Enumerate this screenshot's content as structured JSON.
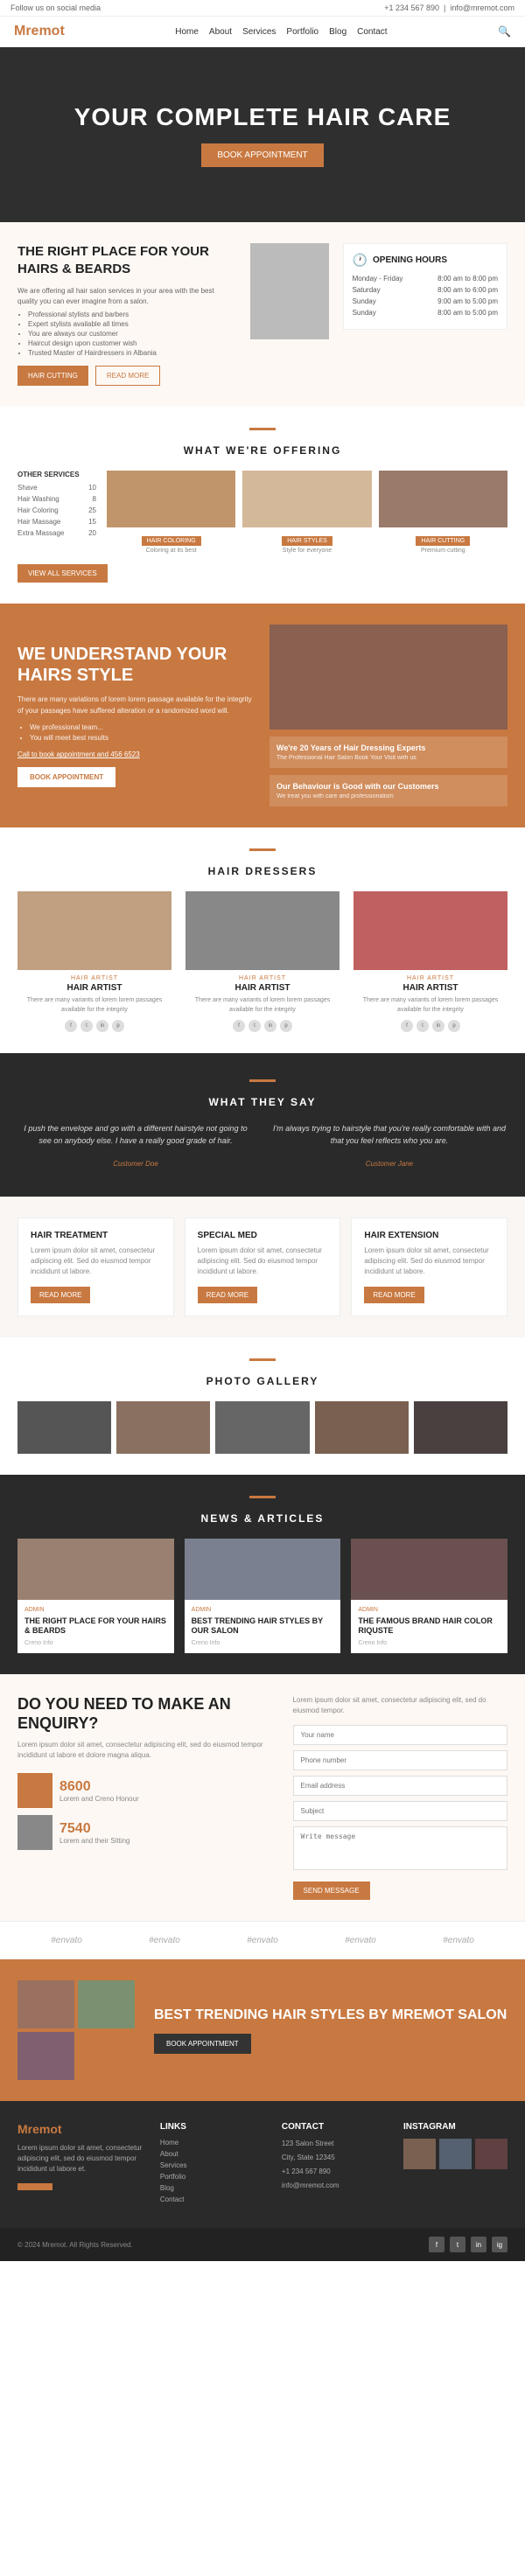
{
  "topbar": {
    "social_text": "Follow us on social media",
    "phone": "+1 234 567 890",
    "email": "info@mremot.com"
  },
  "nav": {
    "logo": "Mremot",
    "links": [
      "Home",
      "About",
      "Services",
      "Portfolio",
      "Blog",
      "Contact"
    ],
    "search_icon": "🔍"
  },
  "hero": {
    "title": "YOUR COMPLETE HAIR CARE",
    "button": "BOOK APPOINTMENT"
  },
  "intro": {
    "heading": "THE RIGHT PLACE FOR YOUR HAIRS & BEARDS",
    "description": "We are offering all hair salon services in your area with the best quality you can ever imagine from a salon.",
    "bullets": [
      "Professional stylists and barbers",
      "Expert stylists available all times",
      "You are always our customer",
      "Haircut design upon customer wish",
      "Trusted Master of Hairdressers in Albania"
    ],
    "btn_haircut": "HAIR CUTTING",
    "btn_more": "READ MORE",
    "opening_hours": {
      "title": "OPENING HOURS",
      "days": [
        {
          "day": "Monday - Friday",
          "hours": "8:00 am to 8:00 pm"
        },
        {
          "day": "Saturday",
          "hours": "8:00 am to 6:00 pm"
        },
        {
          "day": "Sunday",
          "hours": "9:00 am to 5:00 pm"
        },
        {
          "day": "Sunday",
          "hours": "8:00 am to 5:00 pm"
        }
      ]
    }
  },
  "offering": {
    "title": "WHAT WE'RE OFFERING",
    "other_services": {
      "heading": "OTHER SERVICES",
      "items": [
        {
          "name": "Shave",
          "price": "10"
        },
        {
          "name": "Hair Washing",
          "price": "8"
        },
        {
          "name": "Hair Coloring",
          "price": "25"
        },
        {
          "name": "Hair Massage",
          "price": "15"
        },
        {
          "name": "Extra Massage",
          "price": "20"
        }
      ]
    },
    "cards": [
      {
        "label": "HAIR COLORING",
        "desc": "Coloring at its best"
      },
      {
        "label": "HAIR STYLES",
        "desc": "Style for everyone"
      },
      {
        "label": "HAIR CUTTING",
        "desc": "Premium cutting"
      }
    ],
    "view_btn": "VIEW ALL SERVICES"
  },
  "understand": {
    "title": "WE UNDERSTAND YOUR HAIRS STYLE",
    "description": "There are many variations of lorem lorem passage available for the integrity of your passages have suffered alteration or a randomized word will.",
    "bullets": [
      "We professional team...",
      "You will meet best results"
    ],
    "link_text": "Call to book appointment and 456 6523",
    "btn": "BOOK APPOINTMENT",
    "badge1": {
      "heading": "We're 20 Years of Hair Dressing Experts",
      "text": "The Professional Hair Salon Book Your Visit with us"
    },
    "badge2": {
      "heading": "Our Behaviour is Good with our Customers",
      "text": "We treat you with care and professionalism"
    }
  },
  "dressers": {
    "title": "HAIR DRESSERS",
    "items": [
      {
        "role": "HAIR ARTIST",
        "name": "HAIR ARTIST",
        "desc": "There are many variants of lorem lorem passages available for the integrity"
      },
      {
        "role": "HAIR ARTIST",
        "name": "HAIR ARTIST",
        "desc": "There are many variants of lorem lorem passages available for the integrity"
      },
      {
        "role": "HAIR ARTIST",
        "name": "HAIR ARTIST",
        "desc": "There are many variants of lorem lorem passages available for the integrity"
      }
    ]
  },
  "testimonials": {
    "title": "WHAT THEY SAY",
    "items": [
      {
        "quote": "I push the envelope and go with a different hairstyle not going to see on anybody else. I have a really good grade of hair.",
        "author": "Customer Doe"
      },
      {
        "quote": "I'm always trying to hairstyle that you're really comfortable with and that you feel reflects who you are.",
        "author": "Customer Jane"
      }
    ]
  },
  "service_boxes": [
    {
      "title": "HAIR TREATMENT",
      "desc": "Lorem ipsum dolor sit amet, consectetur adipiscing elit. Sed do eiusmod tempor incididunt ut labore.",
      "btn": "READ MORE"
    },
    {
      "title": "SPECIAL MED",
      "desc": "Lorem ipsum dolor sit amet, consectetur adipiscing elit. Sed do eiusmod tempor incididunt ut labore.",
      "btn": "READ MORE"
    },
    {
      "title": "HAIR EXTENSION",
      "desc": "Lorem ipsum dolor sit amet, consectetur adipiscing elit. Sed do eiusmod tempor incididunt ut labore.",
      "btn": "READ MORE"
    }
  ],
  "gallery": {
    "title": "PHOTO GALLERY",
    "items": [
      "photo1",
      "photo2",
      "photo3",
      "photo4",
      "photo5"
    ]
  },
  "news": {
    "title": "NEWS & ARTICLES",
    "items": [
      {
        "tag": "ADMIN",
        "title": "THE RIGHT PLACE FOR YOUR HAIRS & BEARDS",
        "date": "Creno Info"
      },
      {
        "tag": "ADMIN",
        "title": "BEST TRENDING HAIR STYLES BY OUR SALON",
        "date": "Creno Info"
      },
      {
        "tag": "ADMIN",
        "title": "THE FAMOUS BRAND HAIR COLOR RIQUSTE",
        "date": "Creno Info"
      }
    ]
  },
  "enquiry": {
    "title": "DO YOU NEED TO MAKE AN ENQUIRY?",
    "desc": "Lorem ipsum dolor sit amet, consectetur adipiscing elit, sed do eiusmod tempor incididunt ut labore et dolore magna aliqua.",
    "stats": [
      {
        "number": "8600",
        "label": "Lorem and Creno Honour"
      },
      {
        "number": "7540",
        "label": "Lorem and their Sitting"
      }
    ],
    "form": {
      "intro": "Lorem ipsum dolor sit amet, consectetur adipiscing elit, sed do eiusmod tempor.",
      "your_name": "Your name",
      "phone_number": "Phone number",
      "email_address": "Email address",
      "subject": "Subject",
      "write_message": "Write message",
      "submit_btn": "SEND MESSAGE"
    }
  },
  "partners": [
    "#envato",
    "#envato",
    "#envato",
    "#envato",
    "#envato"
  ],
  "cta": {
    "title": "BEST TRENDING HAIR STYLES BY MREMOT SALON",
    "btn": "BOOK APPOINTMENT"
  },
  "footer": {
    "logo": "Mremot",
    "description": "Lorem ipsum dolor sit amet, consectetur adipiscing elit, sed do eiusmod tempor incididunt ut labore et.",
    "links_title": "LINKS",
    "links": [
      "Home",
      "About",
      "Services",
      "Portfolio",
      "Blog",
      "Contact"
    ],
    "contact_title": "CONTACT",
    "contact_info": [
      "123 Salon Street",
      "City, State 12345",
      "+1 234 567 890",
      "info@mremot.com"
    ],
    "instagram_title": "INSTAGRAM",
    "copyright": "© 2024 Mremot. All Rights Reserved."
  }
}
